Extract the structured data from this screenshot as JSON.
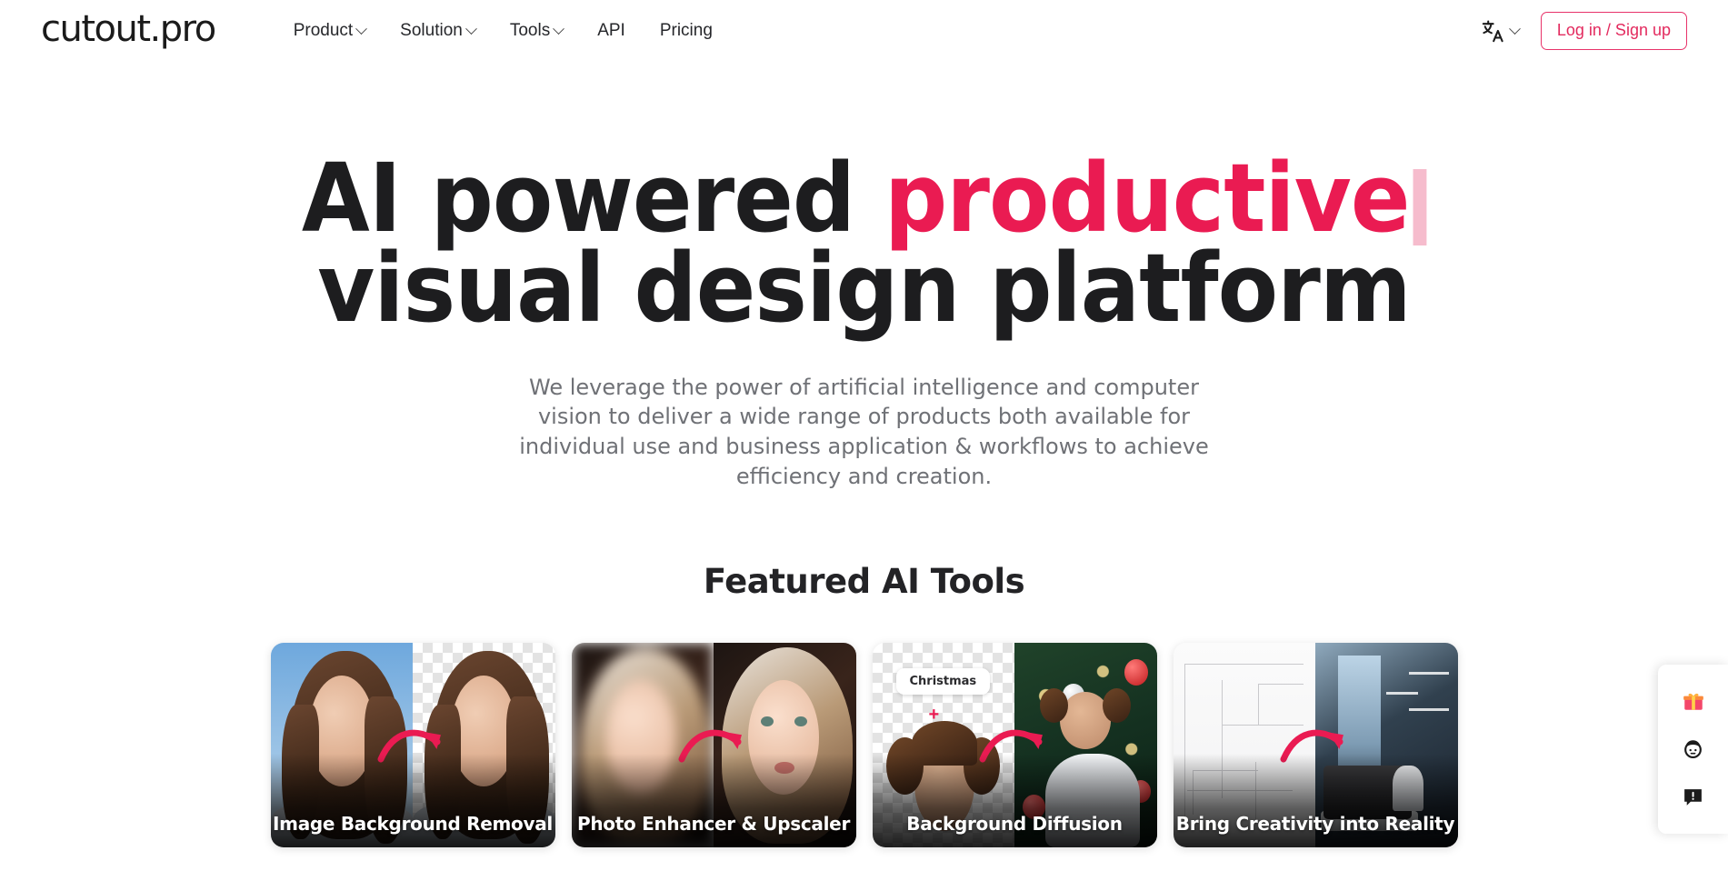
{
  "header": {
    "logo": "cutout.pro",
    "nav": [
      {
        "label": "Product",
        "has_dropdown": true,
        "name": "nav-item-product"
      },
      {
        "label": "Solution",
        "has_dropdown": true,
        "name": "nav-item-solution"
      },
      {
        "label": "Tools",
        "has_dropdown": true,
        "name": "nav-item-tools"
      },
      {
        "label": "API",
        "has_dropdown": false,
        "name": "nav-item-api"
      },
      {
        "label": "Pricing",
        "has_dropdown": false,
        "name": "nav-item-pricing"
      }
    ],
    "language_icon": "translate-icon",
    "login_label": "Log in / Sign up"
  },
  "hero": {
    "line1_plain": "AI powered ",
    "line1_highlight": "productive",
    "line2": "visual design platform",
    "subtitle": "We leverage the power of artificial intelligence and computer vision to deliver a wide range of products both available for individual use and business application & workflows to achieve efficiency and creation."
  },
  "featured": {
    "title": "Featured AI Tools",
    "cards": [
      {
        "label": "Image Background Removal",
        "name": "card-image-background-removal"
      },
      {
        "label": "Photo Enhancer & Upscaler",
        "name": "card-photo-enhancer-upscaler"
      },
      {
        "label": "Background Diffusion",
        "name": "card-background-diffusion",
        "prompt_pill": "Christmas",
        "plus": "+"
      },
      {
        "label": "Bring Creativity into Reality",
        "name": "card-bring-creativity-into-reality"
      }
    ]
  },
  "side_panel": {
    "items": [
      {
        "icon": "gift-icon",
        "name": "side-panel-gift-button"
      },
      {
        "icon": "avatar-icon",
        "name": "side-panel-account-button"
      },
      {
        "icon": "feedback-icon",
        "name": "side-panel-feedback-button"
      }
    ]
  },
  "colors": {
    "accent": "#ea1b52",
    "accent_border": "#e8336a",
    "text_dark": "#1d1d1f",
    "text_muted": "#6f7176",
    "caret": "#f6bccd"
  }
}
